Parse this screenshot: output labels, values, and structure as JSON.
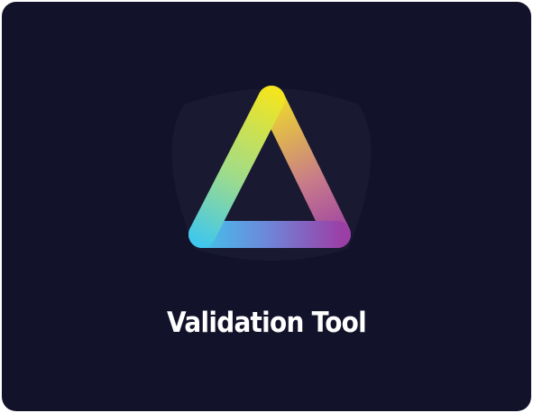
{
  "app": {
    "title": "Validation Tool",
    "icon": "triangle-logo-icon"
  },
  "colors": {
    "background": "#12122a",
    "gradient_yellow": "#f3e520",
    "gradient_cyan": "#3fc7ee",
    "gradient_purple": "#9b3fa6"
  }
}
